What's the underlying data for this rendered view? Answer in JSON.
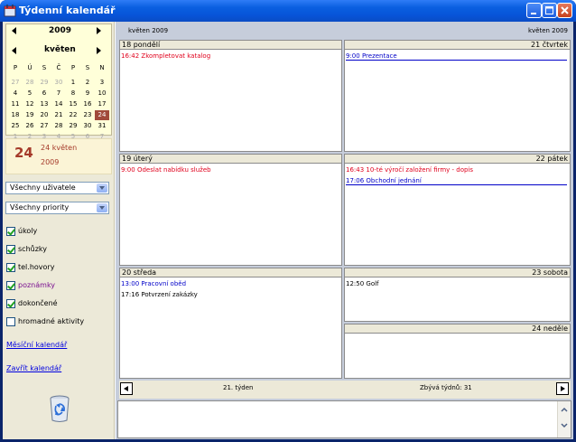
{
  "window": {
    "title": "Týdenní kalendář"
  },
  "sidebar": {
    "year": "2009",
    "month": "květen",
    "weekdays": [
      "P",
      "Ú",
      "S",
      "Č",
      "P",
      "S",
      "N"
    ],
    "weeks": [
      [
        "27",
        "28",
        "29",
        "30",
        "1",
        "2",
        "3"
      ],
      [
        "4",
        "5",
        "6",
        "7",
        "8",
        "9",
        "10"
      ],
      [
        "11",
        "12",
        "13",
        "14",
        "15",
        "16",
        "17"
      ],
      [
        "18",
        "19",
        "20",
        "21",
        "22",
        "23",
        "24"
      ],
      [
        "25",
        "26",
        "27",
        "28",
        "29",
        "30",
        "31"
      ],
      [
        "1",
        "2",
        "3",
        "4",
        "5",
        "6",
        "7"
      ]
    ],
    "today_num": "24",
    "today_line1": "24 květen",
    "today_line2": "2009",
    "users_combo": "Všechny uživatele",
    "priority_combo": "Všechny priority",
    "checks": [
      {
        "label": "úkoly",
        "checked": true,
        "color": "#000000"
      },
      {
        "label": "schůzky",
        "checked": true,
        "color": "#000000"
      },
      {
        "label": "tel.hovory",
        "checked": true,
        "color": "#000000"
      },
      {
        "label": "poznámky",
        "checked": true,
        "color": "#7a1090"
      },
      {
        "label": "dokončené",
        "checked": true,
        "color": "#000000"
      },
      {
        "label": "hromadné aktivity",
        "checked": false,
        "color": "#000000"
      }
    ],
    "link_month": "Měsíční kalendář",
    "link_close": "Zavřít kalendář"
  },
  "main": {
    "header_left": "květen 2009",
    "header_right": "květen 2009",
    "days": {
      "mon": {
        "title": "18 pondělí",
        "events": [
          {
            "text": "16:42 Zkompletovat katalog",
            "color": "red"
          }
        ]
      },
      "thu": {
        "title": "21 čtvrtek",
        "events": [
          {
            "text": "9:00  Prezentace",
            "color": "blue",
            "line": true
          }
        ]
      },
      "tue": {
        "title": "19 úterý",
        "events": [
          {
            "text": "9:00  Odeslat nabídku služeb",
            "color": "red"
          }
        ]
      },
      "fri": {
        "title": "22 pátek",
        "events": [
          {
            "text": "16:43 10-té výročí založení firmy - dopis",
            "color": "red"
          },
          {
            "text": "17:06 Obchodní jednání",
            "color": "blue",
            "line": true
          }
        ]
      },
      "wed": {
        "title": "20 středa",
        "events": [
          {
            "text": "13:00 Pracovní oběd",
            "color": "blue"
          },
          {
            "text": "17:16 Potvrzení zakázky",
            "color": "black"
          }
        ]
      },
      "sat": {
        "title": "23 sobota",
        "events": [
          {
            "text": "12:50 Golf",
            "color": "black"
          }
        ]
      },
      "sun": {
        "title": "24 neděle",
        "events": []
      }
    },
    "week_label": "21. týden",
    "remaining_label": "Zbývá týdnů: 31"
  }
}
